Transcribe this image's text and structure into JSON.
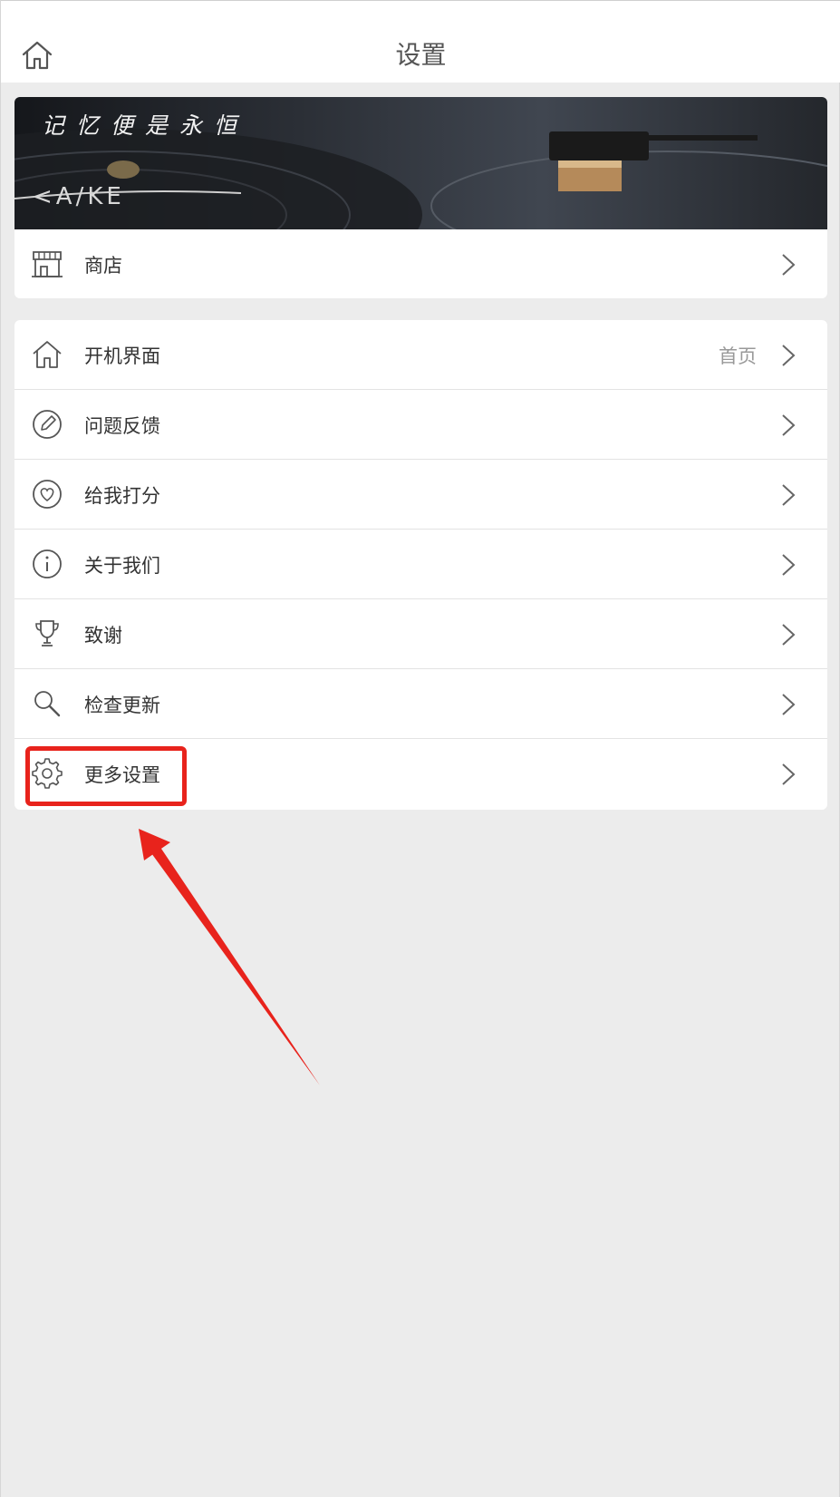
{
  "header": {
    "title": "设置",
    "home_icon": "home-icon"
  },
  "banner": {
    "text": "记忆便是永恒"
  },
  "shop": {
    "label": "商店",
    "icon": "store-icon"
  },
  "menu": [
    {
      "label": "开机界面",
      "value": "首页",
      "icon": "home-icon"
    },
    {
      "label": "问题反馈",
      "value": "",
      "icon": "edit-icon"
    },
    {
      "label": "给我打分",
      "value": "",
      "icon": "heart-icon"
    },
    {
      "label": "关于我们",
      "value": "",
      "icon": "info-icon"
    },
    {
      "label": "致谢",
      "value": "",
      "icon": "trophy-icon"
    },
    {
      "label": "检查更新",
      "value": "",
      "icon": "search-icon"
    },
    {
      "label": "更多设置",
      "value": "",
      "icon": "gear-icon"
    }
  ],
  "annotation": {
    "highlight_color": "#e8231c"
  }
}
